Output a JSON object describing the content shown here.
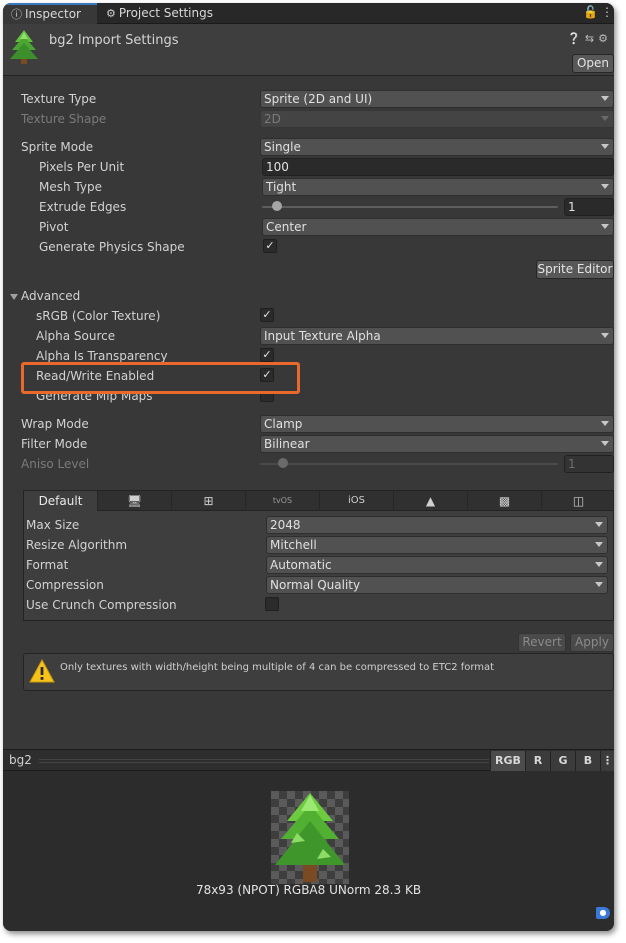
{
  "tabs": [
    {
      "icon": "info-icon",
      "label": "Inspector"
    },
    {
      "icon": "gear-icon",
      "label": "Project Settings"
    }
  ],
  "header": {
    "title": "bg2 Import Settings",
    "open_label": "Open"
  },
  "texture_type": {
    "label": "Texture Type",
    "value": "Sprite (2D and UI)"
  },
  "texture_shape": {
    "label": "Texture Shape",
    "value": "2D"
  },
  "sprite_mode": {
    "label": "Sprite Mode",
    "value": "Single"
  },
  "pixels_per_unit": {
    "label": "Pixels Per Unit",
    "value": "100"
  },
  "mesh_type": {
    "label": "Mesh Type",
    "value": "Tight"
  },
  "extrude_edges": {
    "label": "Extrude Edges",
    "value": "1"
  },
  "pivot": {
    "label": "Pivot",
    "value": "Center"
  },
  "generate_physics_shape": {
    "label": "Generate Physics Shape",
    "checked": true
  },
  "sprite_editor_label": "Sprite Editor",
  "advanced": {
    "label": "Advanced",
    "srgb": {
      "label": "sRGB (Color Texture)",
      "checked": true
    },
    "alpha_source": {
      "label": "Alpha Source",
      "value": "Input Texture Alpha"
    },
    "alpha_is_transparency": {
      "label": "Alpha Is Transparency",
      "checked": true
    },
    "read_write": {
      "label": "Read/Write Enabled",
      "checked": true
    },
    "generate_mip_maps": {
      "label": "Generate Mip Maps",
      "checked": false
    }
  },
  "wrap_mode": {
    "label": "Wrap Mode",
    "value": "Clamp"
  },
  "filter_mode": {
    "label": "Filter Mode",
    "value": "Bilinear"
  },
  "aniso_level": {
    "label": "Aniso Level",
    "value": "1"
  },
  "platform": {
    "tabs": [
      {
        "label": "Default",
        "icon": ""
      },
      {
        "label": "",
        "icon": "monitor-icon"
      },
      {
        "label": "",
        "icon": "windows-icon"
      },
      {
        "label": "tvOS",
        "icon": ""
      },
      {
        "label": "iOS",
        "icon": ""
      },
      {
        "label": "",
        "icon": "android-head-icon"
      },
      {
        "label": "",
        "icon": "android-icon"
      },
      {
        "label": "",
        "icon": "html5-icon"
      }
    ],
    "max_size": {
      "label": "Max Size",
      "value": "2048"
    },
    "resize_algorithm": {
      "label": "Resize Algorithm",
      "value": "Mitchell"
    },
    "format": {
      "label": "Format",
      "value": "Automatic"
    },
    "compression": {
      "label": "Compression",
      "value": "Normal Quality"
    },
    "use_crunch": {
      "label": "Use Crunch Compression",
      "checked": false
    }
  },
  "revert_label": "Revert",
  "apply_label": "Apply",
  "warning_text": "Only textures with width/height being multiple of 4 can be compressed to ETC2 format",
  "preview": {
    "name": "bg2",
    "channels": [
      "RGB",
      "R",
      "G",
      "B"
    ],
    "info": "78x93 (NPOT)  RGBA8 UNorm   28.3 KB"
  },
  "colors": {
    "highlight": "#e9692c",
    "tab_accent": "#3a79bb",
    "warning": "#f7c31b"
  }
}
